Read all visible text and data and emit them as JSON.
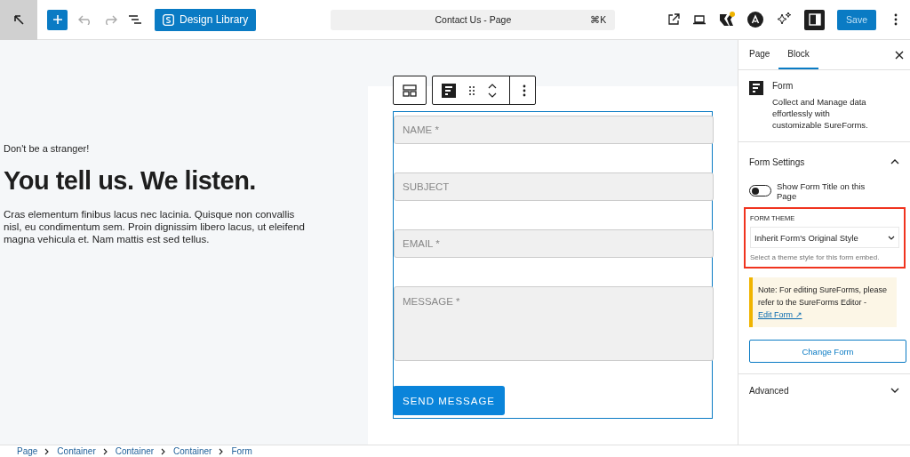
{
  "toolbar": {
    "library_button": "Design Library",
    "command": {
      "title": "Contact Us - Page",
      "shortcut": "⌘K"
    },
    "save_button": "Save"
  },
  "canvas": {
    "eyebrow": "Don't be a stranger!",
    "heading": "You tell us. We listen.",
    "body": "Cras elementum finibus lacus nec lacinia. Quisque non convallis nisl, eu condimentum sem. Proin dignissim libero lacus, ut eleifend magna vehicula et. Nam mattis est sed tellus.",
    "form": {
      "fields": [
        {
          "kind": "input",
          "placeholder": "NAME *"
        },
        {
          "kind": "input",
          "placeholder": "SUBJECT"
        },
        {
          "kind": "input",
          "placeholder": "EMAIL *"
        },
        {
          "kind": "textarea",
          "placeholder": "MESSAGE *"
        }
      ],
      "submit": "SEND MESSAGE"
    }
  },
  "sidebar": {
    "tabs": [
      {
        "label": "Page",
        "selected": false
      },
      {
        "label": "Block",
        "selected": true
      }
    ],
    "block": {
      "name": "Form",
      "description": "Collect and Manage data effortlessly with customizable SureForms."
    },
    "settings": {
      "title": "Form Settings",
      "expanded": true,
      "toggle": {
        "label": "Show Form Title on this Page",
        "on": false
      },
      "theme": {
        "label": "FORM THEME",
        "value": "Inherit Form's Original Style",
        "help": "Select a theme style for this form embed.",
        "highlighted": true
      },
      "note": {
        "text": "Note: For editing SureForms, please refer to the SureForms Editor -",
        "link": "Edit Form ↗"
      },
      "change_button": "Change Form"
    },
    "advanced": {
      "title": "Advanced",
      "expanded": false
    }
  },
  "breadcrumb": [
    "Page",
    "Container",
    "Container",
    "Container",
    "Form"
  ]
}
